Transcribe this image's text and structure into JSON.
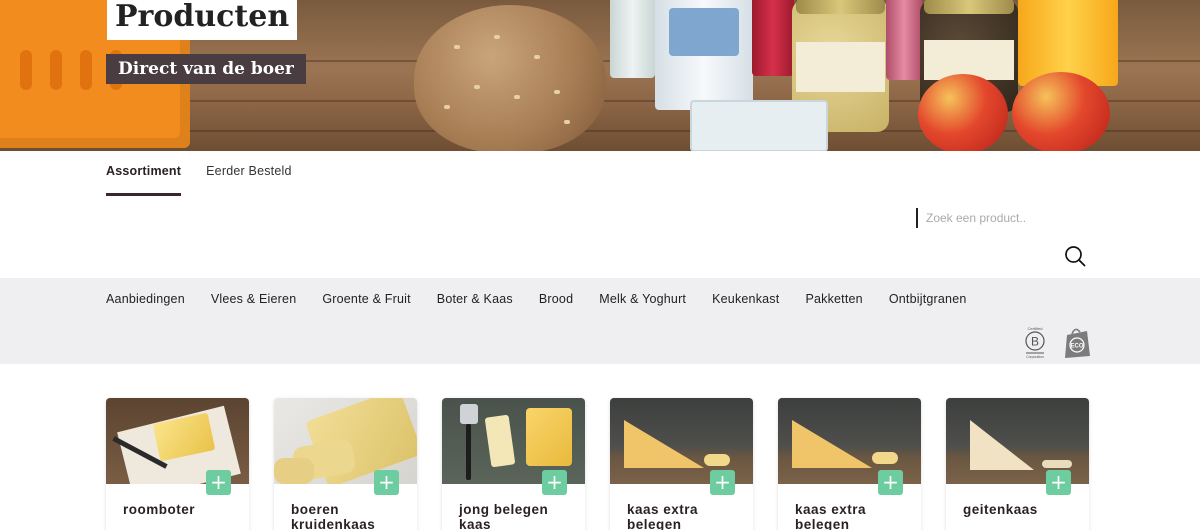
{
  "hero": {
    "title": "Producten",
    "subtitle": "Direct van de boer"
  },
  "tabs": [
    {
      "label": "Assortiment",
      "active": true
    },
    {
      "label": "Eerder Besteld",
      "active": false
    }
  ],
  "search": {
    "placeholder": "Zoek een product.."
  },
  "categories": [
    "Aanbiedingen",
    "Vlees & Eieren",
    "Groente & Fruit",
    "Boter & Kaas",
    "Brood",
    "Melk & Yoghurt",
    "Keukenkast",
    "Pakketten",
    "Ontbijtgranen"
  ],
  "badges": {
    "b_corp": {
      "top": "Certified",
      "letter": "B",
      "bottom": "Corporation"
    },
    "eco": {
      "label": "ECO"
    }
  },
  "products": [
    {
      "name": "roomboter",
      "image": "butter"
    },
    {
      "name": "boeren kruidenkaas",
      "image": "herb-cheese-slices"
    },
    {
      "name": "jong belegen kaas",
      "image": "cheese-with-slicer"
    },
    {
      "name": "kaas extra belegen",
      "image": "cheese-wedge"
    },
    {
      "name": "kaas extra belegen",
      "image": "cheese-wedge"
    },
    {
      "name": "geitenkaas",
      "image": "goat-cheese-wedge"
    }
  ],
  "add_label": "+",
  "colors": {
    "accent_green": "#6dcca0",
    "tab_underline": "#3b2630",
    "subtitle_bg": "#4a3d42",
    "category_bar_bg": "#efeff2"
  }
}
